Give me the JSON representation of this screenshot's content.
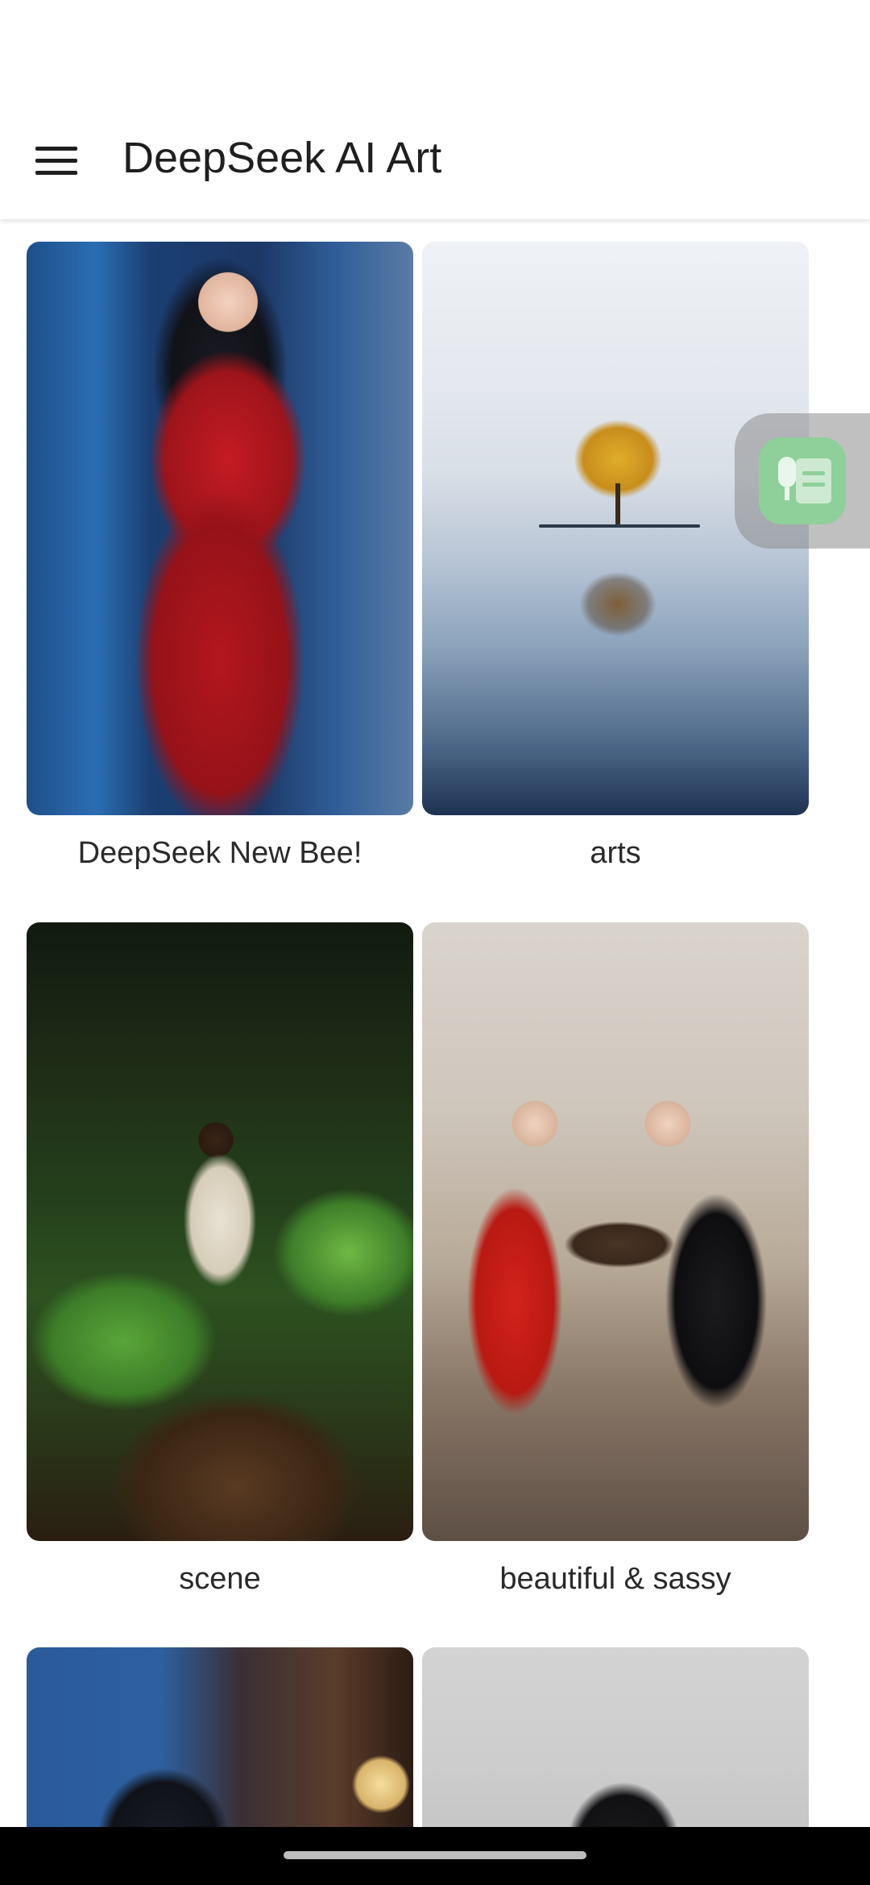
{
  "app_bar": {
    "title": "DeepSeek AI Art",
    "menu_icon": "hamburger-menu-icon"
  },
  "grid": {
    "items": [
      {
        "caption": "DeepSeek New Bee!"
      },
      {
        "caption": "arts"
      },
      {
        "caption": "scene"
      },
      {
        "caption": "beautiful & sassy"
      },
      {
        "caption": ""
      },
      {
        "caption": ""
      }
    ]
  },
  "floating_widget": {
    "icon": "voice-to-text-icon"
  },
  "colors": {
    "background": "#ffffff",
    "title_text": "#1f1f1f",
    "widget_green": "#8fcf9a",
    "nav_bar": "#000000"
  }
}
